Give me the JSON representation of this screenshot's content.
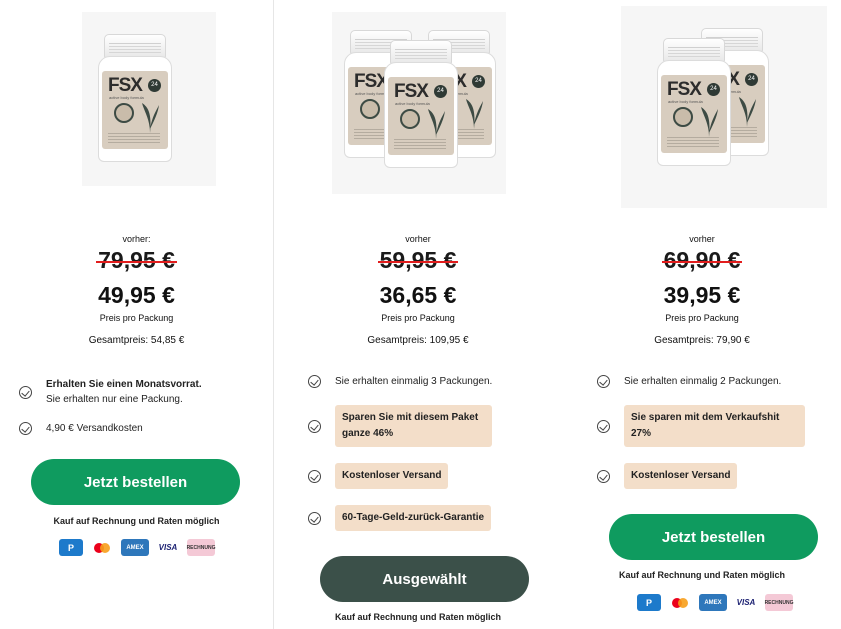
{
  "product": {
    "brand": "FSX",
    "badge_num": "24",
    "subtitle": "active body formula"
  },
  "offers": [
    {
      "before_label": "vorher:",
      "old_price": "79,95 €",
      "new_price": "49,95 €",
      "per_pack": "Preis pro Packung",
      "total": "Gesamtpreis: 54,85 €",
      "features": [
        {
          "bold": "Erhalten Sie einen Monatsvorrat.",
          "text": "Sie erhalten nur eine Packung."
        },
        {
          "text": "4,90 € Versandkosten"
        }
      ],
      "button": "Jetzt bestellen",
      "note": "Kauf auf Rechnung und Raten möglich"
    },
    {
      "before_label": "vorher",
      "old_price": "59,95 €",
      "new_price": "36,65 €",
      "per_pack": "Preis pro Packung",
      "total": "Gesamtpreis: 109,95 €",
      "features": [
        {
          "text": "Sie erhalten einmalig 3 Packungen."
        },
        {
          "badge": "Sparen Sie mit diesem Paket ganze 46%"
        },
        {
          "badge": "Kostenloser Versand"
        },
        {
          "badge": "60-Tage-Geld-zurück-Garantie"
        }
      ],
      "button": "Ausgewählt",
      "note": "Kauf auf Rechnung und Raten möglich"
    },
    {
      "before_label": "vorher",
      "old_price": "69,90 €",
      "new_price": "39,95 €",
      "per_pack": "Preis pro Packung",
      "total": "Gesamtpreis: 79,90 €",
      "features": [
        {
          "text": "Sie erhalten einmalig 2 Packungen."
        },
        {
          "badge": "Sie sparen mit dem Verkaufshit 27%"
        },
        {
          "badge": "Kostenloser Versand"
        }
      ],
      "button": "Jetzt bestellen",
      "note": "Kauf auf Rechnung und Raten möglich"
    }
  ],
  "payments": {
    "paypal": "P",
    "amex": "AMEX",
    "visa": "VISA",
    "invoice": "RECHNUNG"
  },
  "colors": {
    "green": "#0f9b5f",
    "dark": "#3b5049",
    "strike": "#e21d1d",
    "badge": "#f3dec9"
  }
}
